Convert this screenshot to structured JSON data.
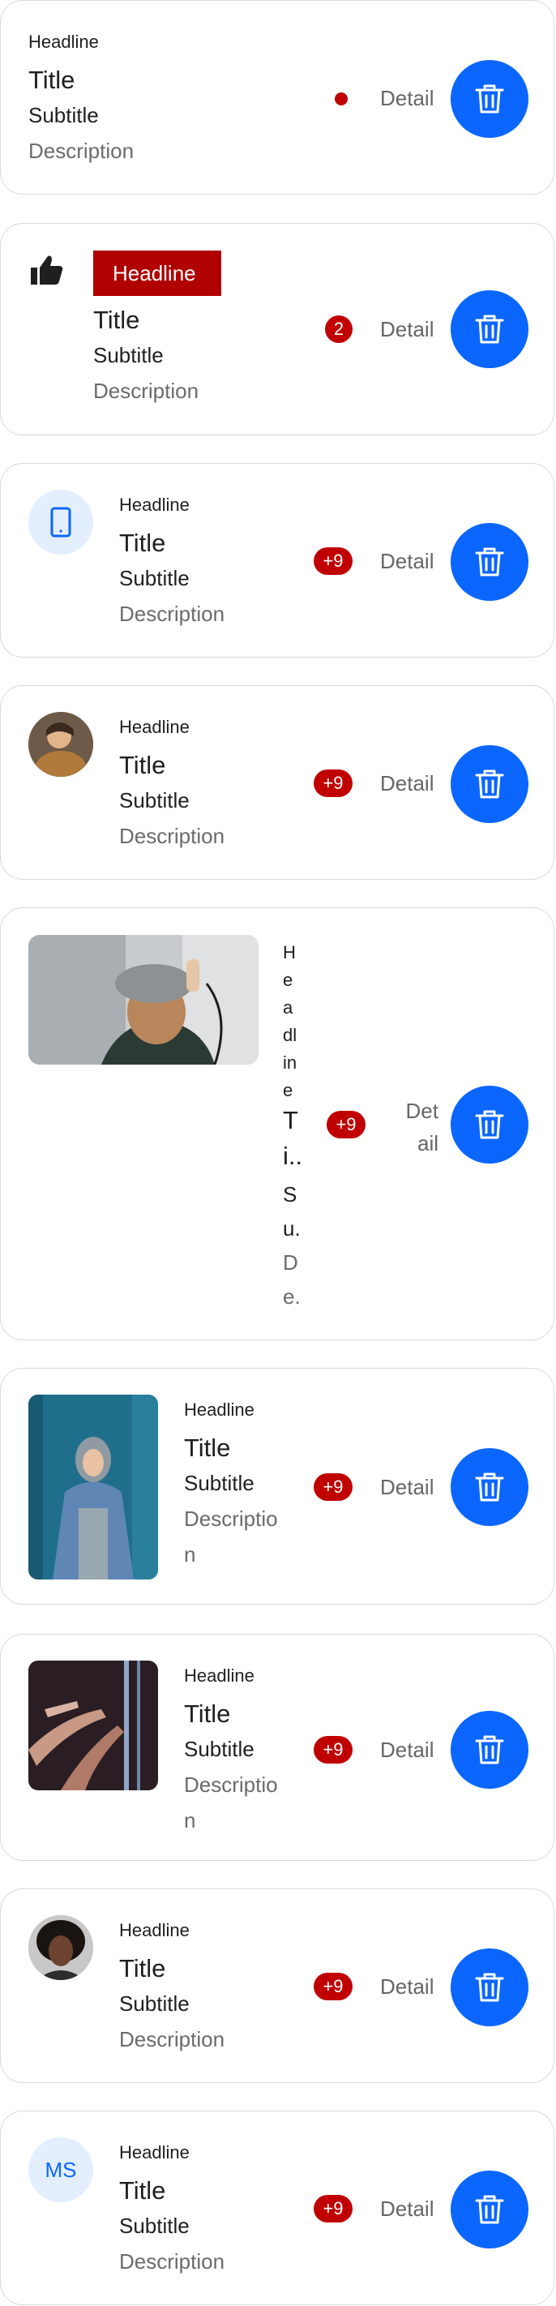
{
  "cards": [
    {
      "headline": "Headline",
      "title": "Title",
      "subtitle": "Subtitle",
      "description": "Description",
      "detail": "Detail"
    },
    {
      "headline": "Headline",
      "title": "Title",
      "subtitle": "Subtitle",
      "description": "Description",
      "detail": "Detail",
      "badge": "2"
    },
    {
      "headline": "Headline",
      "title": "Title",
      "subtitle": "Subtitle",
      "description": "Description",
      "detail": "Detail",
      "badge": "+9"
    },
    {
      "headline": "Headline",
      "title": "Title",
      "subtitle": "Subtitle",
      "description": "Description",
      "detail": "Detail",
      "badge": "+9"
    },
    {
      "headline_lines": [
        "H",
        "e",
        "a",
        "dl",
        "in",
        "e"
      ],
      "title": "T",
      "title_tail": "i..",
      "subtitle": "S",
      "subtitle_tail": "u.",
      "description": "D",
      "description_tail": "e.",
      "detail_lines": [
        "Det",
        "ail"
      ],
      "badge": "+9"
    },
    {
      "headline": "Headline",
      "title": "Title",
      "subtitle": "Subtitle",
      "description_lines": [
        "Descriptio",
        "n"
      ],
      "detail": "Detail",
      "badge": "+9"
    },
    {
      "headline": "Headline",
      "title": "Title",
      "subtitle": "Subtitle",
      "description_lines": [
        "Descriptio",
        "n"
      ],
      "detail": "Detail",
      "badge": "+9"
    },
    {
      "headline": "Headline",
      "title": "Title",
      "subtitle": "Subtitle",
      "description": "Description",
      "detail": "Detail",
      "badge": "+9"
    },
    {
      "headline": "Headline",
      "title": "Title",
      "subtitle": "Subtitle",
      "description": "Description",
      "detail": "Detail",
      "badge": "+9",
      "initials": "MS"
    }
  ],
  "icons": {
    "delete": "trash-icon",
    "like": "thumb-up-icon",
    "phone": "smartphone-icon"
  },
  "colors": {
    "accent": "#0a66ff",
    "badge": "#c00000",
    "avatar_bg": "#e3efff"
  }
}
